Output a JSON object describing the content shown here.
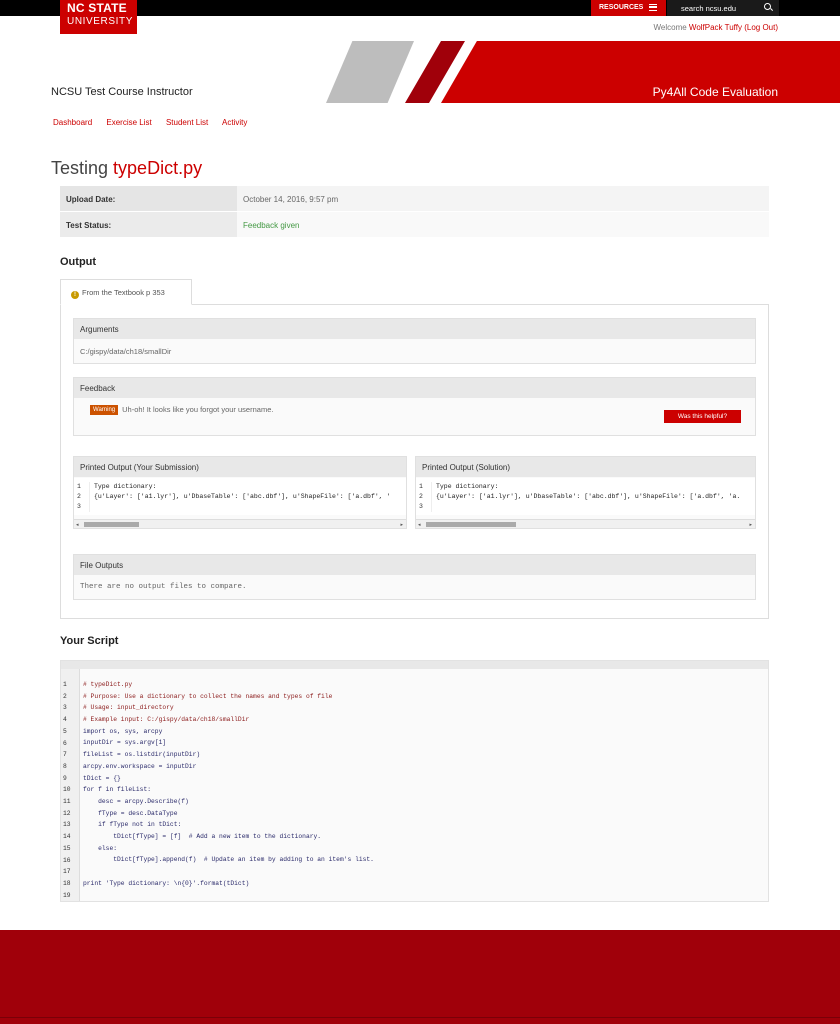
{
  "header": {
    "logo_line1": "NC STATE",
    "logo_line2": "UNIVERSITY",
    "resources_label": "RESOURCES",
    "search_placeholder": "search ncsu.edu",
    "welcome_prefix": "Welcome ",
    "welcome_name": "WolfPack Tuffy",
    "logout_label": "(Log Out)"
  },
  "banner": {
    "course_title": "NCSU Test Course Instructor",
    "app_title": "Py4All Code Evaluation"
  },
  "nav": {
    "items": [
      "Dashboard",
      "Exercise List",
      "Student List",
      "Activity"
    ]
  },
  "page": {
    "title_prefix": "Testing ",
    "file_name": "typeDict.py"
  },
  "info": {
    "upload_label": "Upload Date:",
    "upload_value": "October 14, 2016, 9:57 pm",
    "status_label": "Test Status:",
    "status_value": "Feedback given"
  },
  "output": {
    "heading": "Output",
    "tab_label": "From the Textbook p 353",
    "arguments_title": "Arguments",
    "arguments_value": "C:/gispy/data/ch18/smallDir",
    "feedback_title": "Feedback",
    "warning_badge": "Warning",
    "warning_text": "Uh-oh! It looks like you forgot your username.",
    "helpful_button": "Was this helpful?",
    "submission_title": "Printed Output (Your Submission)",
    "solution_title": "Printed Output (Solution)",
    "submission_lines": [
      "Type dictionary:",
      "{u'Layer': ['a1.lyr'], u'DbaseTable': ['abc.dbf'], u'ShapeFile': ['a.dbf', '",
      ""
    ],
    "solution_lines": [
      "Type dictionary:",
      "{u'Layer': ['a1.lyr'], u'DbaseTable': ['abc.dbf'], u'ShapeFile': ['a.dbf', 'a.",
      ""
    ],
    "line_numbers": "1\n2\n3",
    "file_outputs_title": "File Outputs",
    "file_outputs_text": "There are no output files to compare."
  },
  "script": {
    "heading": "Your Script",
    "line_numbers": "1\n2\n3\n4\n5\n6\n7\n8\n9\n10\n11\n12\n13\n14\n15\n16\n17\n18\n19",
    "lines": [
      "# typeDict.py",
      "# Purpose: Use a dictionary to collect the names and types of file",
      "# Usage: input_directory",
      "# Example input: C:/gispy/data/ch18/smallDir",
      "import os, sys, arcpy",
      "inputDir = sys.argv[1]",
      "fileList = os.listdir(inputDir)",
      "arcpy.env.workspace = inputDir",
      "tDict = {}",
      "for f in fileList:",
      "    desc = arcpy.Describe(f)",
      "    fType = desc.DataType",
      "    if fType not in tDict:",
      "        tDict[fType] = [f]  # Add a new item to the dictionary.",
      "    else:",
      "        tDict[fType].append(f)  # Update an item by adding to an item's list.",
      "",
      "print 'Type dictionary: \\n{0}'.format(tDict)",
      ""
    ]
  },
  "colors": {
    "brand_red": "#cc0000",
    "dark_red": "#a0000a",
    "status_green": "#449944",
    "warning_orange": "#cc5200"
  }
}
